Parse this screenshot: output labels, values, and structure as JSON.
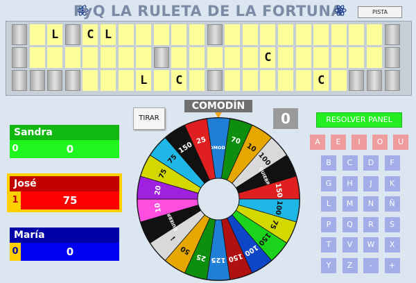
{
  "title": "FyQ LA RULETA DE LA FORTUNA",
  "pista_label": "PISTA",
  "board": {
    "rows": [
      [
        "g",
        "y",
        "L",
        "g",
        "C",
        "L",
        "y",
        "y",
        "y",
        "y",
        "y",
        "g",
        "y",
        "y",
        "y",
        "y",
        "y",
        "y",
        "y",
        "y",
        "y",
        "g"
      ],
      [
        "g",
        "y",
        "y",
        "y",
        "y",
        "y",
        "y",
        "y",
        "g",
        "y",
        "y",
        "y",
        "y",
        "y",
        "C",
        "y",
        "y",
        "y",
        "y",
        "y",
        "y",
        "g"
      ],
      [
        "g",
        "g",
        "g",
        "g",
        "y",
        "y",
        "y",
        "L",
        "y",
        "C",
        "y",
        "g",
        "y",
        "y",
        "y",
        "y",
        "y",
        "C",
        "y",
        "g",
        "g",
        "g"
      ]
    ]
  },
  "comodin_label": "COMODÍN",
  "tirar_label": "TIRAR",
  "current_score": "0",
  "resolver_label": "RESOLVER PANEL",
  "players": [
    {
      "name": "Sandra",
      "index": "0",
      "score": "0",
      "name_bg": "#12b812",
      "score_bg": "#1ff51f",
      "idx_bg": "#1ff51f",
      "idx_color": "#ffffff",
      "active": false
    },
    {
      "name": "José",
      "index": "1",
      "score": "75",
      "name_bg": "#c10000",
      "score_bg": "#ff0000",
      "idx_bg": "#ffd000",
      "idx_color": "#c10000",
      "active": true
    },
    {
      "name": "María",
      "index": "0",
      "score": "0",
      "name_bg": "#0000a8",
      "score_bg": "#0000f0",
      "idx_bg": "#ffd000",
      "idx_color": "#0000a8",
      "active": false
    }
  ],
  "vowels": [
    "A",
    "E",
    "I",
    "O",
    "U"
  ],
  "consonants": [
    "B",
    "C",
    "D",
    "F",
    "G",
    "H",
    "J",
    "K",
    "L",
    "M",
    "N",
    "Ñ",
    "P",
    "Q",
    "R",
    "S",
    "T",
    "V",
    "W",
    "X",
    "Y",
    "Z",
    "-",
    "+"
  ],
  "wheel": {
    "segments": [
      {
        "label": "COMODÍN",
        "color": "#1f7fd6"
      },
      {
        "label": "70",
        "color": "#0d8f0d"
      },
      {
        "label": "10",
        "color": "#e6a800"
      },
      {
        "label": "100",
        "color": "#d9d9d9"
      },
      {
        "label": "QUIEBRA",
        "color": "#111111"
      },
      {
        "label": "150",
        "color": "#e02020"
      },
      {
        "label": "100",
        "color": "#1fb8e6"
      },
      {
        "label": "75",
        "color": "#d3d800"
      },
      {
        "label": "150",
        "color": "#1bd31b"
      },
      {
        "label": "100",
        "color": "#0d47c7"
      },
      {
        "label": "150",
        "color": "#b01010"
      },
      {
        "label": "125",
        "color": "#1f7fd6"
      },
      {
        "label": "25",
        "color": "#0d8f0d"
      },
      {
        "label": "50",
        "color": "#e6a800"
      },
      {
        "label": "¡",
        "color": "#d9d9d9"
      },
      {
        "label": "QUIEBRA",
        "color": "#111111"
      },
      {
        "label": "10",
        "color": "#ff4de0"
      },
      {
        "label": "20",
        "color": "#a020e0"
      },
      {
        "label": "75",
        "color": "#d3d800"
      },
      {
        "label": "75",
        "color": "#1fb8e6"
      },
      {
        "label": "150",
        "color": "#111111"
      },
      {
        "label": "25",
        "color": "#e02020"
      }
    ]
  }
}
